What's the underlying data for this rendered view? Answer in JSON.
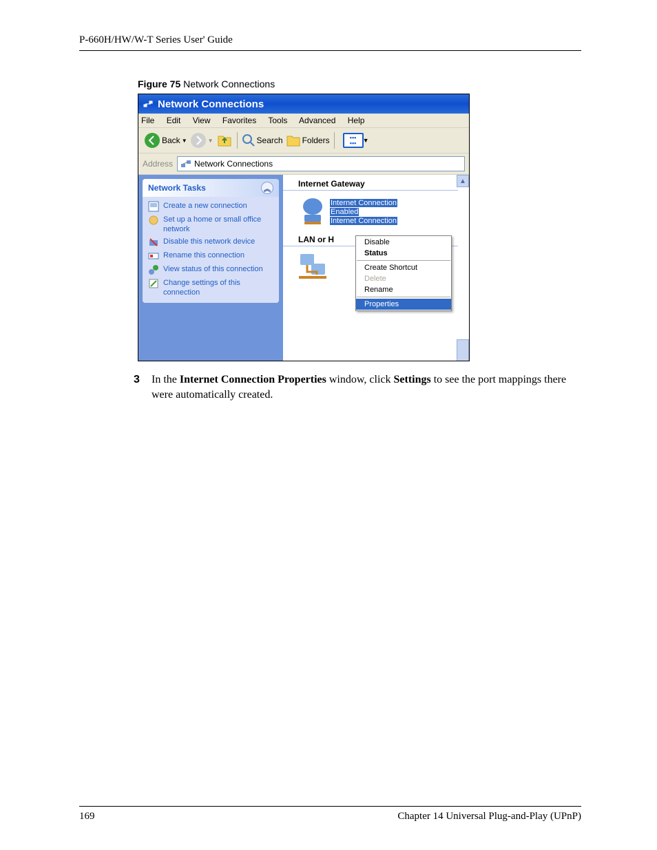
{
  "header_text": "P-660H/HW/W-T Series User' Guide",
  "figure": {
    "label_bold": "Figure 75",
    "label_rest": "   Network Connections"
  },
  "window": {
    "title": "Network Connections",
    "menus": [
      "File",
      "Edit",
      "View",
      "Favorites",
      "Tools",
      "Advanced",
      "Help"
    ],
    "toolbar": {
      "back": "Back",
      "search": "Search",
      "folders": "Folders"
    },
    "address_label": "Address",
    "address_value": "Network Connections",
    "sidebar": {
      "panel_title": "Network Tasks",
      "tasks": [
        "Create a new connection",
        "Set up a home or small office network",
        "Disable this network device",
        "Rename this connection",
        "View status of this connection",
        "Change settings of this connection"
      ]
    },
    "groups": {
      "g1": "Internet Gateway",
      "g2": "LAN or H"
    },
    "item": {
      "line1": "Internet Connection",
      "line2": "Enabled",
      "line3": "Internet Connection"
    },
    "context_menu": {
      "disable": "Disable",
      "status": "Status",
      "create_shortcut": "Create Shortcut",
      "delete": "Delete",
      "rename": "Rename",
      "properties": "Properties"
    }
  },
  "step": {
    "num": "3",
    "t1": "In the ",
    "b1": "Internet Connection Properties",
    "t2": " window, click ",
    "b2": "Settings",
    "t3": " to see the port mappings there were automatically created."
  },
  "footer": {
    "page": "169",
    "chapter": "Chapter 14 Universal Plug-and-Play (UPnP)"
  }
}
